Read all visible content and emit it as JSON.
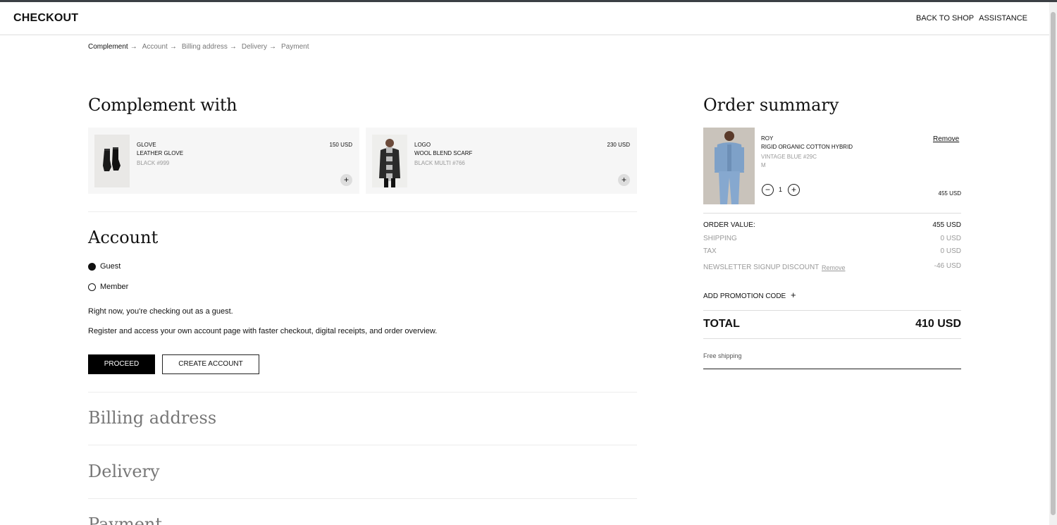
{
  "header": {
    "title": "CHECKOUT",
    "links": [
      "BACK TO SHOP",
      "ASSISTANCE"
    ]
  },
  "breadcrumb": [
    "Complement",
    "Account",
    "Billing address",
    "Delivery",
    "Payment"
  ],
  "complement": {
    "heading": "Complement with",
    "items": [
      {
        "brand": "GLOVE",
        "name": "LEATHER GLOVE",
        "variant": "BLACK #999",
        "price": "150 USD",
        "add_label": "+"
      },
      {
        "brand": "LOGO",
        "name": "WOOL BLEND SCARF",
        "variant": "BLACK MULTI #766",
        "price": "230 USD",
        "add_label": "+"
      }
    ]
  },
  "account": {
    "heading": "Account",
    "options": [
      "Guest",
      "Member"
    ],
    "selected": "Guest",
    "text1": "Right now, you're checking out as a guest.",
    "text2": "Register and access your own account page with faster checkout, digital receipts, and order overview.",
    "proceed_label": "PROCEED",
    "create_label": "CREATE ACCOUNT"
  },
  "sections": [
    "Billing address",
    "Delivery",
    "Payment"
  ],
  "summary": {
    "heading": "Order summary",
    "product": {
      "brand": "ROY",
      "name": "RIGID ORGANIC COTTON HYBRID",
      "color": "VINTAGE BLUE #29C",
      "size": "M",
      "qty": "1",
      "price": "455 USD",
      "remove_label": "Remove"
    },
    "rows": [
      {
        "label": "ORDER VALUE:",
        "value": "455 USD"
      },
      {
        "label": "SHIPPING",
        "value": "0 USD"
      },
      {
        "label": "TAX",
        "value": "0 USD"
      },
      {
        "label": "NEWSLETTER SIGNUP DISCOUNT",
        "value": "-46 USD",
        "remove_label": "Remove"
      }
    ],
    "promo_label": "ADD PROMOTION CODE",
    "total_label": "TOTAL",
    "total_value": "410 USD",
    "free_shipping": "Free shipping"
  },
  "icons": {
    "arrow": "→",
    "plus": "+",
    "minus": "−"
  }
}
